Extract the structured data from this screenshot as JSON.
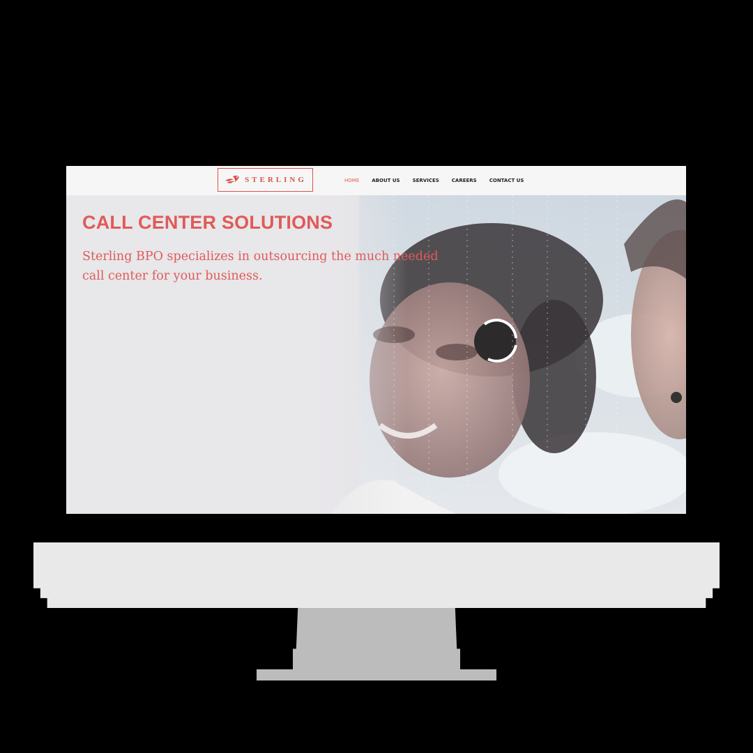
{
  "brand": {
    "logo_text": "STERLING",
    "accent_color": "#e05a57",
    "logo_icon": "flame-bird-icon"
  },
  "nav": {
    "items": [
      {
        "label": "HOME",
        "active": true
      },
      {
        "label": "ABOUT US",
        "active": false
      },
      {
        "label": "SERVICES",
        "active": false
      },
      {
        "label": "CAREERS",
        "active": false
      },
      {
        "label": "CONTACT US",
        "active": false
      }
    ]
  },
  "hero": {
    "title": "CALL CENTER SOLUTIONS",
    "subtitle": "Sterling BPO specializes in outsourcing the much needed call center for your business.",
    "image": "call-center-agents-photo"
  },
  "device": {
    "type": "desktop-monitor",
    "bezel_color": "#000000",
    "base_color": "#e9e9e9",
    "stand_color": "#bcbcbc"
  }
}
